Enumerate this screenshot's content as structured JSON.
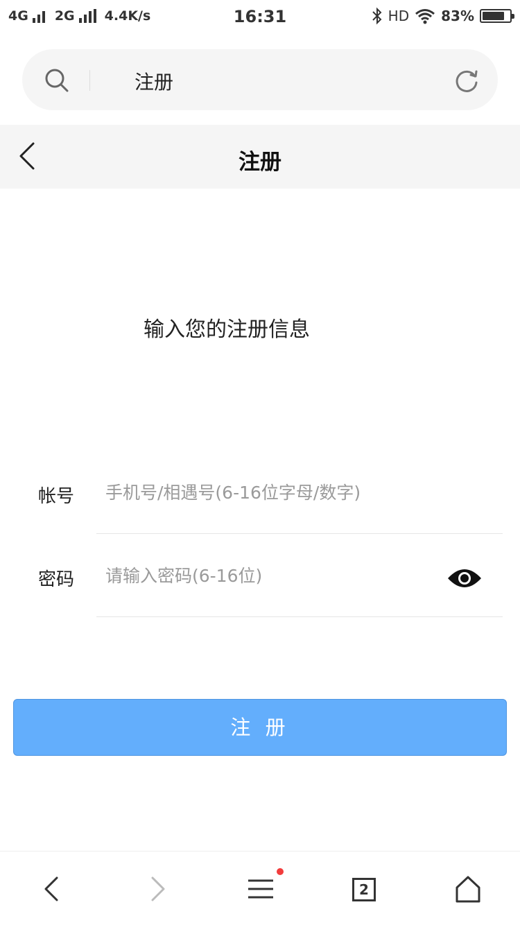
{
  "status_bar": {
    "network1": "4G",
    "network2": "2G",
    "speed": "4.4K/s",
    "time": "16:31",
    "hd": "HD",
    "battery": "83%",
    "battery_level": 0.83
  },
  "address_bar": {
    "text": "注册",
    "search_icon": "search-icon",
    "reload_icon": "reload-icon"
  },
  "header": {
    "title": "注册",
    "back_icon": "chevron-left-icon"
  },
  "form": {
    "heading": "输入您的注册信息",
    "account": {
      "label": "帐号",
      "value": "",
      "placeholder": "手机号/相遇号(6-16位字母/数字)"
    },
    "password": {
      "label": "密码",
      "value": "",
      "placeholder": "请输入密码(6-16位)",
      "visibility_icon": "eye-icon"
    },
    "submit_label": "注 册",
    "button_color": "#63aefc"
  },
  "bottom_nav": {
    "items": [
      "back-icon",
      "forward-icon",
      "menu-icon",
      "tabs-icon",
      "home-icon"
    ],
    "tab_count": "2",
    "menu_badge_color": "#f23c3c"
  }
}
